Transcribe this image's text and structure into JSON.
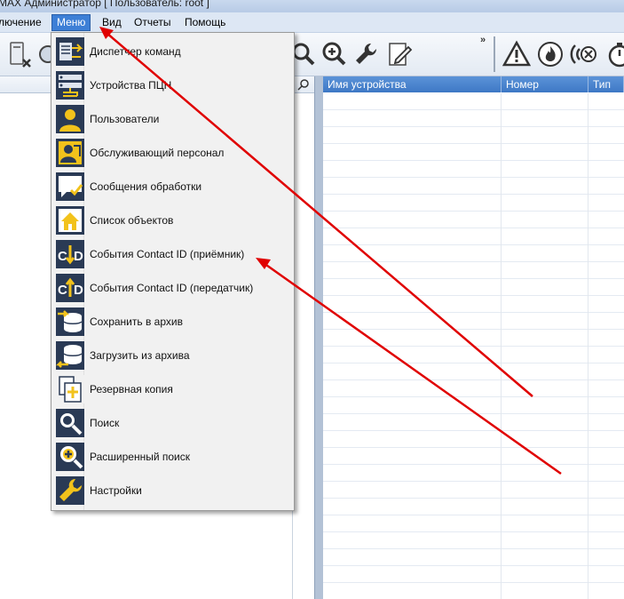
{
  "window": {
    "title": "MAX Администратор [ Пользователь: root ]"
  },
  "menubar": {
    "items": [
      {
        "label": "лючение"
      },
      {
        "label": "Меню"
      },
      {
        "label": "Вид"
      },
      {
        "label": "Отчеты"
      },
      {
        "label": "Помощь"
      }
    ]
  },
  "toolbar": {
    "overflow_label": "»",
    "icons": [
      "device-remove-icon",
      "device-icon",
      "search-icon",
      "advanced-search-icon",
      "settings-wrench-icon",
      "edit-pen-icon",
      "alarm-warning-icon",
      "fire-icon",
      "signal-cancel-icon",
      "timer-icon"
    ]
  },
  "table": {
    "columns": [
      "Имя устройства",
      "Номер",
      "Тип"
    ]
  },
  "menu": {
    "items": [
      {
        "label": "Диспетчер команд",
        "icon": "command-dispatcher-icon"
      },
      {
        "label": "Устройства ПЦН",
        "icon": "pcn-devices-icon"
      },
      {
        "label": "Пользователи",
        "icon": "users-icon"
      },
      {
        "label": "Обслуживающий персонал",
        "icon": "service-staff-icon"
      },
      {
        "label": "Сообщения обработки",
        "icon": "processing-messages-icon"
      },
      {
        "label": "Список объектов",
        "icon": "objects-list-icon"
      },
      {
        "label": "События Contact ID (приёмник)",
        "icon": "contact-id-receiver-icon"
      },
      {
        "label": "События Contact ID (передатчик)",
        "icon": "contact-id-transmitter-icon"
      },
      {
        "label": "Сохранить в архив",
        "icon": "archive-save-icon"
      },
      {
        "label": "Загрузить из архива",
        "icon": "archive-load-icon"
      },
      {
        "label": "Резервная копия",
        "icon": "backup-icon"
      },
      {
        "label": "Поиск",
        "icon": "search-icon"
      },
      {
        "label": "Расширенный поиск",
        "icon": "advanced-search-icon"
      },
      {
        "label": "Настройки",
        "icon": "settings-icon"
      }
    ]
  },
  "colors": {
    "accent": "#3d7fd6",
    "icon_bg": "#2a3a55",
    "icon_yellow": "#f2c21b",
    "annotation_arrow": "#e00000"
  }
}
